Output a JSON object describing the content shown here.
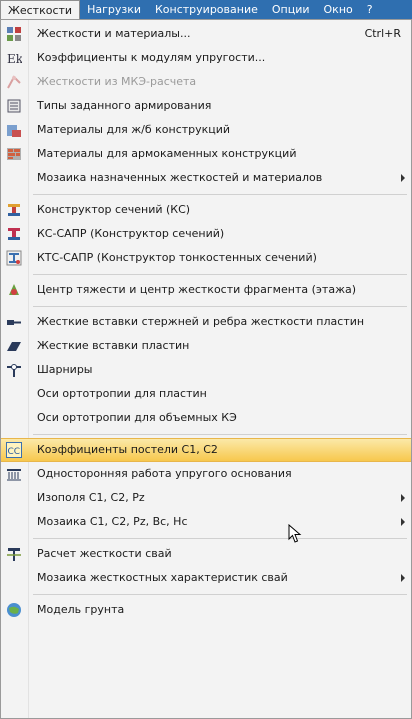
{
  "menubar": {
    "items": [
      "Жесткости",
      "Нагрузки",
      "Конструирование",
      "Опции",
      "Окно",
      "?"
    ]
  },
  "menu": {
    "items": [
      {
        "label": "Жесткости и материалы...",
        "shortcut": "Ctrl+R",
        "icon": "stiffness-materials-icon"
      },
      {
        "label": "Коэффициенты к модулям упругости...",
        "icon": "ek-icon"
      },
      {
        "label": "Жесткости из МКЭ-расчета",
        "icon": "fem-stiffness-icon",
        "disabled": true
      },
      {
        "label": "Типы заданного армирования",
        "icon": "reinforcement-types-icon"
      },
      {
        "label": "Материалы для ж/б конструкций",
        "icon": "rc-materials-icon"
      },
      {
        "label": "Материалы для армокаменных конструкций",
        "icon": "masonry-materials-icon"
      },
      {
        "label": "Мозаика назначенных жесткостей и материалов",
        "submenu": true
      },
      {
        "label": "Конструктор сечений (КС)",
        "icon": "section-constructor-icon"
      },
      {
        "label": "КС-САПР (Конструктор сечений)",
        "icon": "section-cad-icon"
      },
      {
        "label": "КТС-САПР (Конструктор тонкостенных сечений)",
        "icon": "thin-wall-section-icon"
      },
      {
        "label": "Центр тяжести и центр жесткости фрагмента (этажа)",
        "icon": "gravity-center-icon"
      },
      {
        "label": "Жесткие вставки стержней и ребра жесткости пластин",
        "icon": "rigid-inserts-bars-icon"
      },
      {
        "label": "Жесткие вставки пластин",
        "icon": "rigid-inserts-plates-icon"
      },
      {
        "label": "Шарниры",
        "icon": "hinge-icon"
      },
      {
        "label": "Оси ортотропии для пластин"
      },
      {
        "label": "Оси ортотропии для объемных КЭ"
      },
      {
        "label": "Коэффициенты постели С1, С2",
        "icon": "subgrade-coefficients-icon",
        "highlighted": true
      },
      {
        "label": "Односторонняя работа упругого основания",
        "icon": "one-way-foundation-icon"
      },
      {
        "label": "Изополя С1, С2, Pz",
        "submenu": true
      },
      {
        "label": "Мозаика С1, С2, Pz, Bc, Hc",
        "submenu": true
      },
      {
        "label": "Расчет жесткости свай",
        "icon": "pile-stiffness-icon"
      },
      {
        "label": "Мозаика жесткостных характеристик свай",
        "submenu": true
      },
      {
        "label": "Модель грунта",
        "icon": "soil-model-icon"
      }
    ]
  },
  "colors": {
    "menubar_bg": "#2f6fb0",
    "highlight": "#f7c84e"
  }
}
